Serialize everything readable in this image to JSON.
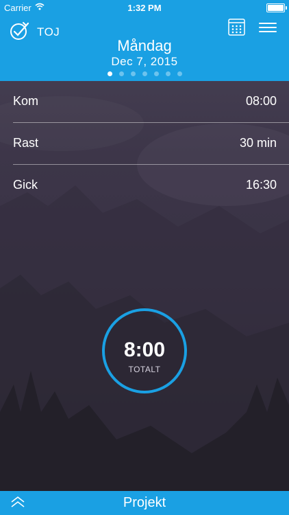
{
  "status": {
    "carrier": "Carrier",
    "time": "1:32 PM"
  },
  "header": {
    "brand": "TOJ",
    "day": "Måndag",
    "date": "Dec 7, 2015",
    "page_count": 7,
    "active_page": 1
  },
  "rows": [
    {
      "label": "Kom",
      "value": "08:00"
    },
    {
      "label": "Rast",
      "value": "30 min"
    },
    {
      "label": "Gick",
      "value": "16:30"
    }
  ],
  "total": {
    "value": "8:00",
    "label": "TOTALT"
  },
  "footer": {
    "label": "Projekt"
  },
  "colors": {
    "accent": "#1aa0e3",
    "ring": "#1aa0e3"
  },
  "icons": {
    "logo": "stopwatch-check-icon",
    "calendar": "calendar-grid-icon",
    "menu": "hamburger-menu-icon",
    "footer": "double-chevron-up-icon"
  }
}
